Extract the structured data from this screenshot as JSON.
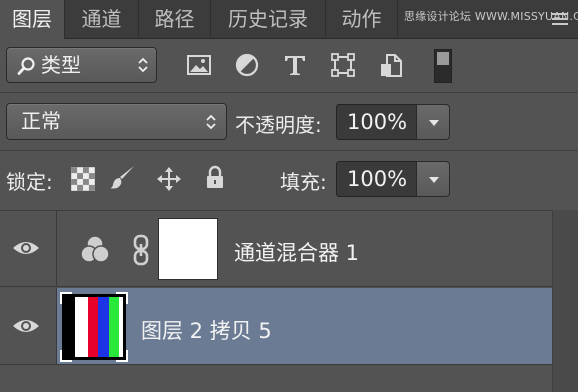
{
  "tabs": [
    {
      "label": "图层",
      "active": true
    },
    {
      "label": "通道",
      "active": false
    },
    {
      "label": "路径",
      "active": false
    },
    {
      "label": "历史记录",
      "active": false
    },
    {
      "label": "动作",
      "active": false
    }
  ],
  "watermark": "思缘设计论坛 WWW.MISSYUAN.COM",
  "filter": {
    "kind_label": "类型",
    "search_icon": "search-icon",
    "icons": [
      "image-filter-icon",
      "adjustment-filter-icon",
      "type-filter-icon",
      "shape-filter-icon",
      "smart-object-filter-icon"
    ]
  },
  "blend": {
    "mode": "正常",
    "opacity_label": "不透明度:",
    "opacity_value": "100%"
  },
  "lock": {
    "label": "锁定:",
    "icons": [
      "lock-transparent-pixels-icon",
      "lock-image-pixels-icon",
      "lock-position-icon",
      "lock-all-icon"
    ],
    "fill_label": "填充:",
    "fill_value": "100%"
  },
  "layers": [
    {
      "name": "通道混合器 1",
      "type": "adjustment",
      "visible": true,
      "selected": false,
      "icons": [
        "channel-mixer-icon",
        "chain-link-icon",
        "layer-mask-thumbnail"
      ]
    },
    {
      "name": "图层 2 拷贝 5",
      "type": "pixel",
      "visible": true,
      "selected": true,
      "thumbnail_colors": [
        "#000000",
        "#ffffff",
        "#e8002a",
        "#1d33e6",
        "#2ae83a",
        "#ffffff"
      ]
    }
  ],
  "colors": {
    "panel_bg": "#535353",
    "selected_row": "#6b7b94",
    "tab_bar": "#3c3c3c"
  }
}
